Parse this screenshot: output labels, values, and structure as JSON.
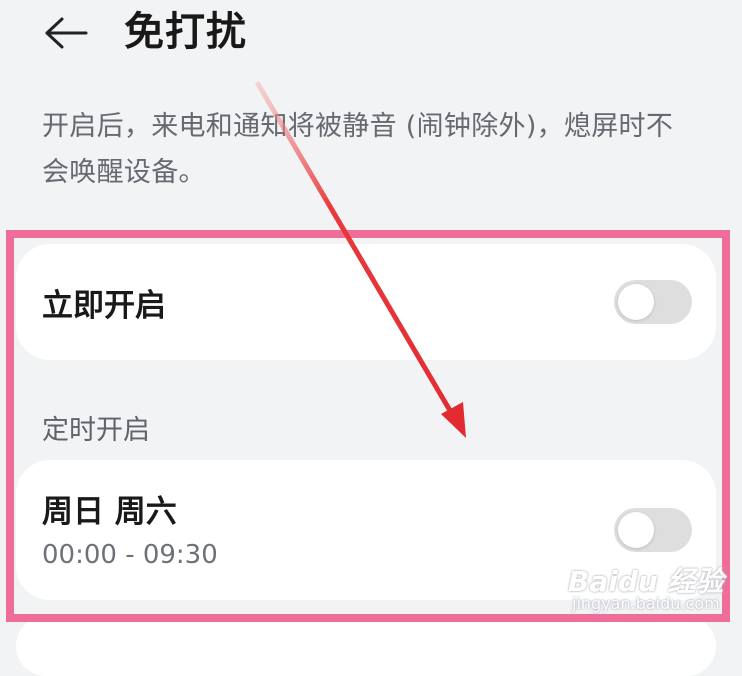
{
  "header": {
    "title": "免打扰",
    "back_icon": "arrow-left-icon"
  },
  "description": "开启后，来电和通知将被静音 (闹钟除外)，熄屏时不会唤醒设备。",
  "immediate": {
    "label": "立即开启",
    "enabled": false
  },
  "scheduled_section": {
    "header": "定时开启",
    "rule": {
      "days": "周日 周六",
      "time_range": "00:00 - 09:30",
      "enabled": false
    }
  },
  "annotation": {
    "highlight_color": "#ef6d99",
    "arrow_color": "#e8393d"
  },
  "watermark": {
    "logo": "Baidu 经验",
    "url": "jingyan.baidu.com"
  }
}
